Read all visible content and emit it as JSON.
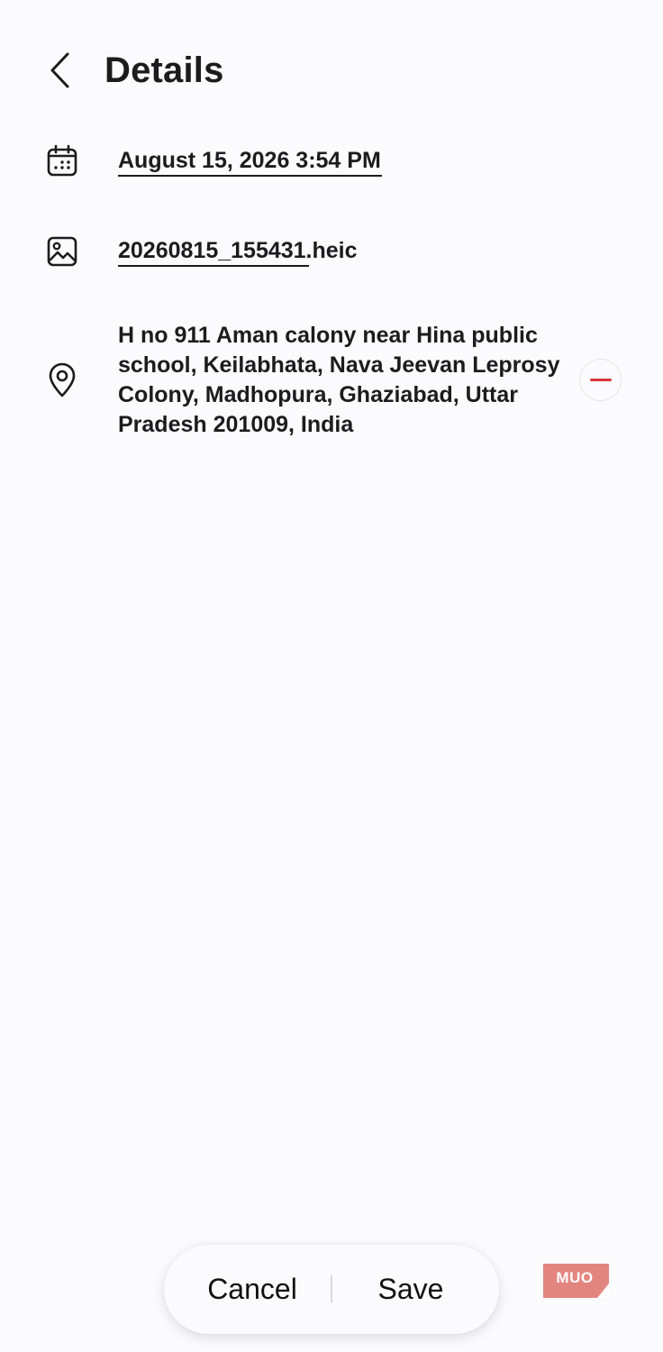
{
  "header": {
    "title": "Details",
    "back_icon": "chevron-left-icon"
  },
  "details": {
    "date_time": "August 15, 2026 3:54 PM",
    "file_name": "20260815_155431.heic",
    "location": "H no 911 Aman calony near Hina public school, Keilabhata, Nava Jeevan Leprosy Colony, Madhopura, Ghaziabad, Uttar Pradesh 201009, India"
  },
  "icons": {
    "date": "calendar-icon",
    "file": "image-icon",
    "location": "location-pin-icon",
    "remove": "remove-icon"
  },
  "actions": {
    "cancel_label": "Cancel",
    "save_label": "Save"
  },
  "watermark": {
    "text": "MUO"
  },
  "colors": {
    "background": "#fbfbfd",
    "text": "#1c1c1e",
    "remove_accent": "#d9363e",
    "logo": "#e3857f"
  }
}
